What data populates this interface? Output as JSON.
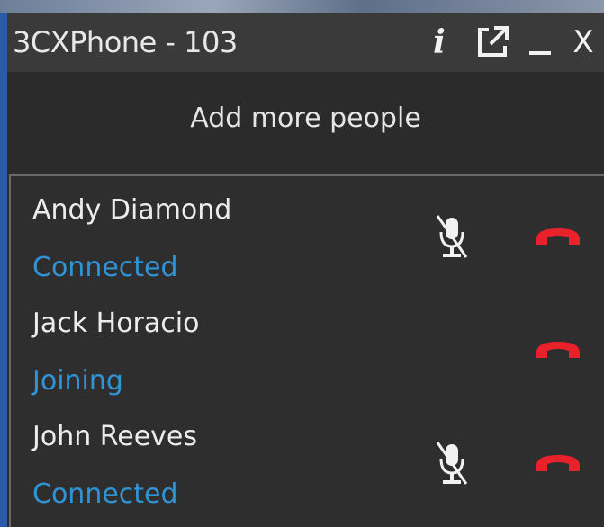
{
  "window": {
    "title": "3CXPhone - 103",
    "info_glyph": "i",
    "close_glyph": "X"
  },
  "actions": {
    "add_people_label": "Add more people"
  },
  "participants": [
    {
      "name": "Andy Diamond",
      "status": "Connected",
      "mute_icon": "mute-microphone-icon",
      "hangup_icon": "hang-up-icon"
    },
    {
      "name": "Jack Horacio",
      "status": "Joining",
      "hangup_icon": "hang-up-icon"
    },
    {
      "name": "John Reeves",
      "status": "Connected",
      "mute_icon": "mute-microphone-icon",
      "hangup_icon": "hang-up-icon"
    }
  ],
  "colors": {
    "status": "#2f93d6",
    "hangup": "#e8212a",
    "background": "#2d2d2d"
  }
}
